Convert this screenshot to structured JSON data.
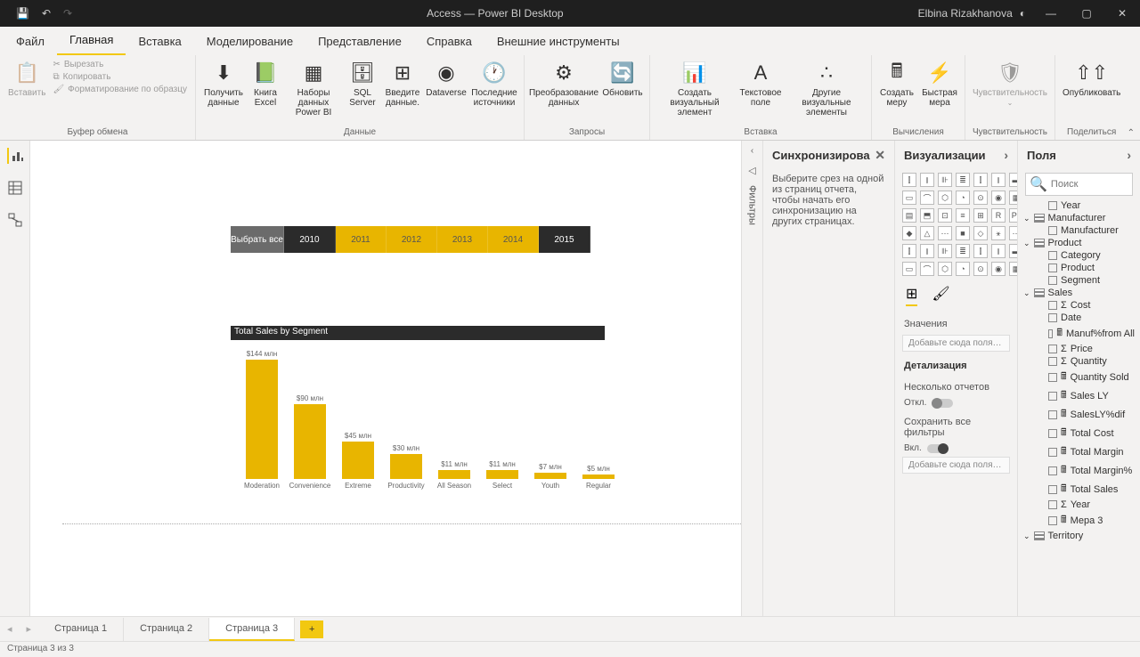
{
  "titlebar": {
    "title": "Access — Power BI Desktop",
    "user": "Elbina Rizakhanova"
  },
  "tabs": [
    "Файл",
    "Главная",
    "Вставка",
    "Моделирование",
    "Представление",
    "Справка",
    "Внешние инструменты"
  ],
  "active_tab": 1,
  "ribbon": {
    "clipboard": {
      "paste": "Вставить",
      "cut": "Вырезать",
      "copy": "Копировать",
      "format": "Форматирование по образцу",
      "label": "Буфер обмена"
    },
    "data": {
      "items": [
        "Получить данные",
        "Книга Excel",
        "Наборы данных Power BI",
        "SQL Server",
        "Введите данные.",
        "Dataverse",
        "Последние источники"
      ],
      "label": "Данные"
    },
    "queries": {
      "items": [
        "Преобразование данных",
        "Обновить"
      ],
      "label": "Запросы"
    },
    "insert": {
      "items": [
        "Создать визуальный элемент",
        "Текстовое поле",
        "Другие визуальные элементы"
      ],
      "label": "Вставка"
    },
    "calc": {
      "items": [
        "Создать меру",
        "Быстрая мера"
      ],
      "label": "Вычисления"
    },
    "sens": {
      "item": "Чувствительность",
      "label": "Чувствительность"
    },
    "share": {
      "item": "Опубликовать",
      "label": "Поделиться"
    }
  },
  "slicer": {
    "all": "Выбрать все",
    "years": [
      "2010",
      "2011",
      "2012",
      "2013",
      "2014",
      "2015"
    ],
    "dark_years": [
      "2010",
      "2015"
    ]
  },
  "chart_data": {
    "type": "bar",
    "title": "Total Sales by Segment",
    "categories": [
      "Moderation",
      "Convenience",
      "Extreme",
      "Productivity",
      "All Season",
      "Select",
      "Youth",
      "Regular"
    ],
    "values": [
      144,
      90,
      45,
      30,
      11,
      11,
      7,
      5
    ],
    "value_labels": [
      "$144 млн",
      "$90 млн",
      "$45 млн",
      "$30 млн",
      "$11 млн",
      "$11 млн",
      "$7 млн",
      "$5 млн"
    ],
    "ylim": [
      0,
      150
    ]
  },
  "filter_label": "Фильтры",
  "sync": {
    "title": "Синхронизирова",
    "body": "Выберите срез на одной из страниц отчета, чтобы начать его синхронизацию на других страницах."
  },
  "viz": {
    "title": "Визуализации",
    "values_label": "Значения",
    "values_well": "Добавьте сюда поля с дан...",
    "drill_label": "Детализация",
    "multi": "Несколько отчетов",
    "off": "Откл.",
    "keep": "Сохранить все фильтры",
    "on": "Вкл.",
    "drill_well": "Добавьте сюда поля дета..."
  },
  "fields": {
    "title": "Поля",
    "search_ph": "Поиск",
    "tree": [
      {
        "type": "field",
        "label": "Year",
        "indent": 2
      },
      {
        "type": "table",
        "label": "Manufacturer",
        "indent": 0
      },
      {
        "type": "field",
        "label": "Manufacturer",
        "indent": 2
      },
      {
        "type": "table",
        "label": "Product",
        "indent": 0
      },
      {
        "type": "field",
        "label": "Category",
        "indent": 2
      },
      {
        "type": "field",
        "label": "Product",
        "indent": 2
      },
      {
        "type": "field",
        "label": "Segment",
        "indent": 2
      },
      {
        "type": "table",
        "label": "Sales",
        "indent": 0
      },
      {
        "type": "sigma",
        "label": "Cost",
        "indent": 2
      },
      {
        "type": "field",
        "label": "Date",
        "indent": 2
      },
      {
        "type": "calc",
        "label": "Manuf%from All",
        "indent": 2
      },
      {
        "type": "sigma",
        "label": "Price",
        "indent": 2
      },
      {
        "type": "sigma",
        "label": "Quantity",
        "indent": 2
      },
      {
        "type": "calc",
        "label": "Quantity Sold",
        "indent": 2
      },
      {
        "type": "calc",
        "label": "Sales LY",
        "indent": 2
      },
      {
        "type": "calc",
        "label": "SalesLY%dif",
        "indent": 2
      },
      {
        "type": "calc",
        "label": "Total Cost",
        "indent": 2
      },
      {
        "type": "calc",
        "label": "Total Margin",
        "indent": 2
      },
      {
        "type": "calc",
        "label": "Total Margin%",
        "indent": 2
      },
      {
        "type": "calc",
        "label": "Total Sales",
        "indent": 2
      },
      {
        "type": "sigma",
        "label": "Year",
        "indent": 2
      },
      {
        "type": "calc",
        "label": "Мера 3",
        "indent": 2
      },
      {
        "type": "table",
        "label": "Territory",
        "indent": 0
      }
    ]
  },
  "pages": {
    "tabs": [
      "Страница 1",
      "Страница 2",
      "Страница 3"
    ],
    "active": 2,
    "add": "+"
  },
  "status": "Страница 3 из 3"
}
